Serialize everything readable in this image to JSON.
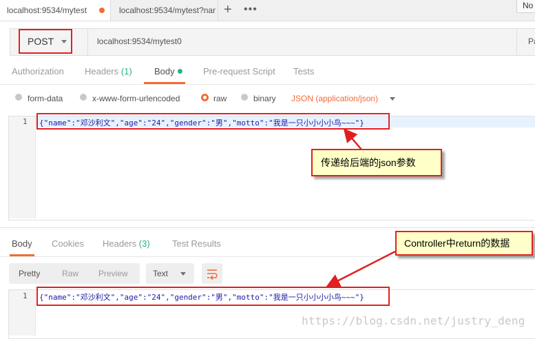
{
  "tabs": [
    {
      "label": "localhost:9534/mytest"
    },
    {
      "label": "localhost:9534/mytest?nam"
    }
  ],
  "tab_controls": {
    "plus": "+",
    "more": "•••"
  },
  "environment": {
    "label": "No"
  },
  "request": {
    "method": "POST",
    "url": "localhost:9534/mytest0",
    "params_label": "Pa"
  },
  "request_tabs": {
    "authorization": "Authorization",
    "headers": "Headers",
    "headers_count": "(1)",
    "body": "Body",
    "prerequest": "Pre-request Script",
    "tests": "Tests"
  },
  "body_modes": {
    "form_data": "form-data",
    "urlencoded": "x-www-form-urlencoded",
    "raw": "raw",
    "binary": "binary",
    "content_type": "JSON (application/json)"
  },
  "request_editor": {
    "line": "1",
    "code": "{\"name\":\"邓沙利文\",\"age\":\"24\",\"gender\":\"男\",\"motto\":\"我是一只小小小小鸟~~~\"}"
  },
  "annotations": {
    "request_note": "传递给后端的json参数",
    "response_note": "Controller中return的数据"
  },
  "response_tabs": {
    "body": "Body",
    "cookies": "Cookies",
    "headers": "Headers",
    "headers_count": "(3)",
    "tests": "Test Results"
  },
  "response_view": {
    "pretty": "Pretty",
    "raw": "Raw",
    "preview": "Preview",
    "format": "Text"
  },
  "response_editor": {
    "line": "1",
    "code": "{\"name\":\"邓沙利文\",\"age\":\"24\",\"gender\":\"男\",\"motto\":\"我是一只小小小小鸟~~~\"}"
  },
  "watermark": "https://blog.csdn.net/justry_deng",
  "colors": {
    "accent": "#f26b3a",
    "annotation_red": "#e02020",
    "count_green": "#26b47f",
    "note_bg": "#ffffc8"
  }
}
